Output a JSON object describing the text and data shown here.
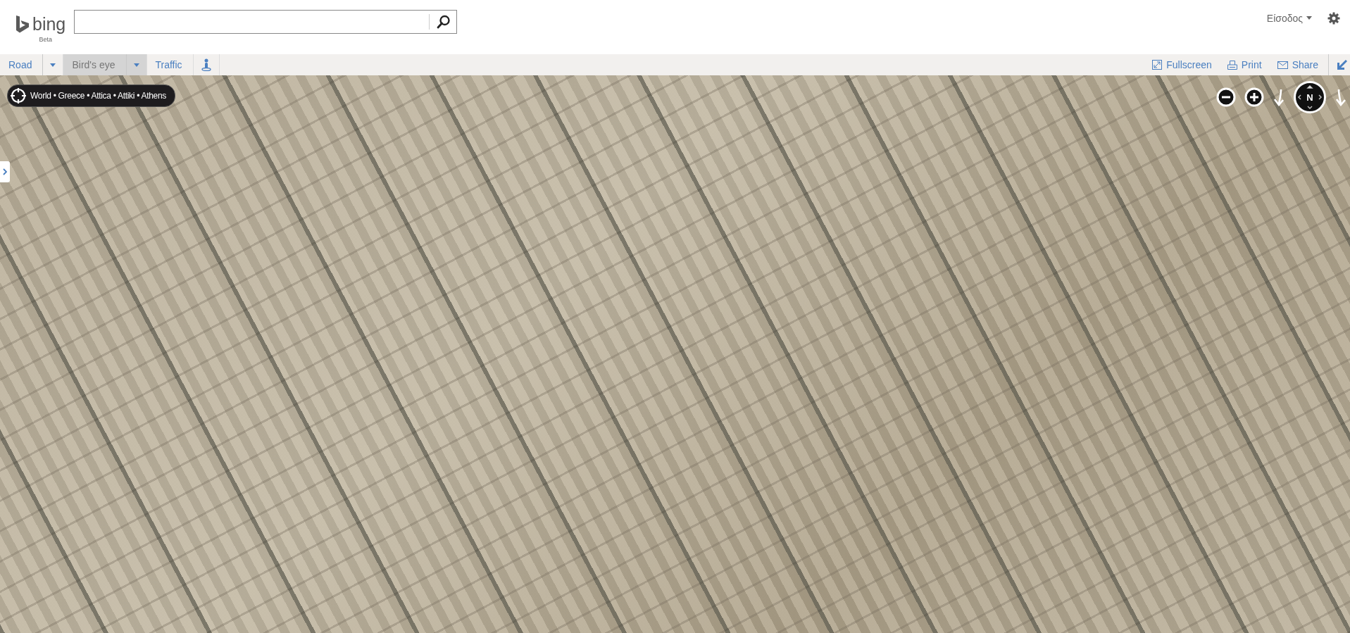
{
  "header": {
    "logo": "bing",
    "logo_sub": "Beta",
    "sign_in": "Είσοδος"
  },
  "toolbar": {
    "tabs": [
      {
        "label": "Road",
        "selected": false,
        "dropdown": true
      },
      {
        "label": "Bird's eye",
        "selected": true,
        "dropdown": true
      },
      {
        "label": "Traffic",
        "selected": false,
        "dropdown": false
      }
    ],
    "actions": [
      {
        "kind": "fullscreen",
        "label": "Fullscreen"
      },
      {
        "kind": "print",
        "label": "Print"
      },
      {
        "kind": "share",
        "label": "Share"
      }
    ]
  },
  "map": {
    "breadcrumb": "World • Greece • Attica • Attiki • Athens",
    "compass": "N"
  }
}
